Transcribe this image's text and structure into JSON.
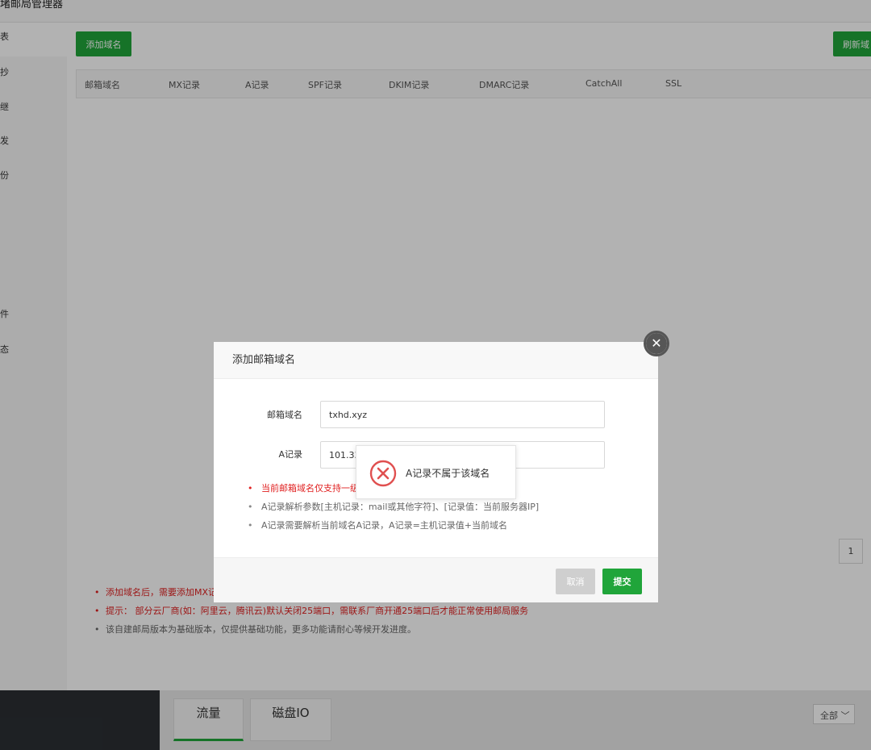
{
  "app": {
    "title": "堵邮局管理器"
  },
  "sidebar": {
    "items": [
      {
        "label": "表"
      },
      {
        "label": "抄"
      },
      {
        "label": "继"
      },
      {
        "label": "发"
      },
      {
        "label": "份"
      },
      {
        "label": "件"
      },
      {
        "label": "态"
      }
    ]
  },
  "toolbar": {
    "add_domain": "添加域名",
    "refresh_domain": "刷新域"
  },
  "table": {
    "columns": [
      "邮箱域名",
      "MX记录",
      "A记录",
      "SPF记录",
      "DKIM记录",
      "DMARC记录",
      "CatchAll",
      "SSL"
    ]
  },
  "pagination": {
    "current": "1"
  },
  "tips": [
    "添加域名后，需要添加MX记",
    "提示：  部分云厂商(如：阿里云，腾讯云)默认关闭25端口，需联系厂商开通25端口后才能正常使用邮局服务",
    "该自建邮局版本为基础版本，仅提供基础功能，更多功能请耐心等候开发进度。"
  ],
  "bottom": {
    "tabs": [
      "流量",
      "磁盘IO"
    ],
    "select_value": "全部"
  },
  "dialog": {
    "title": "添加邮箱域名",
    "domain_label": "邮箱域名",
    "domain_value": "txhd.xyz",
    "a_label": "A记录",
    "a_value": "101.33",
    "help": [
      "当前邮箱域名仅支持一级",
      "A记录解析参数[主机记录：mail或其他字符]、[记录值：当前服务器IP]",
      "A记录需要解析当前域名A记录，A记录=主机记录值+当前域名"
    ],
    "cancel": "取消",
    "submit": "提交"
  },
  "toast": {
    "message": "A记录不属于该域名"
  },
  "colors": {
    "accent": "#20a53a",
    "error": "#e02020"
  }
}
